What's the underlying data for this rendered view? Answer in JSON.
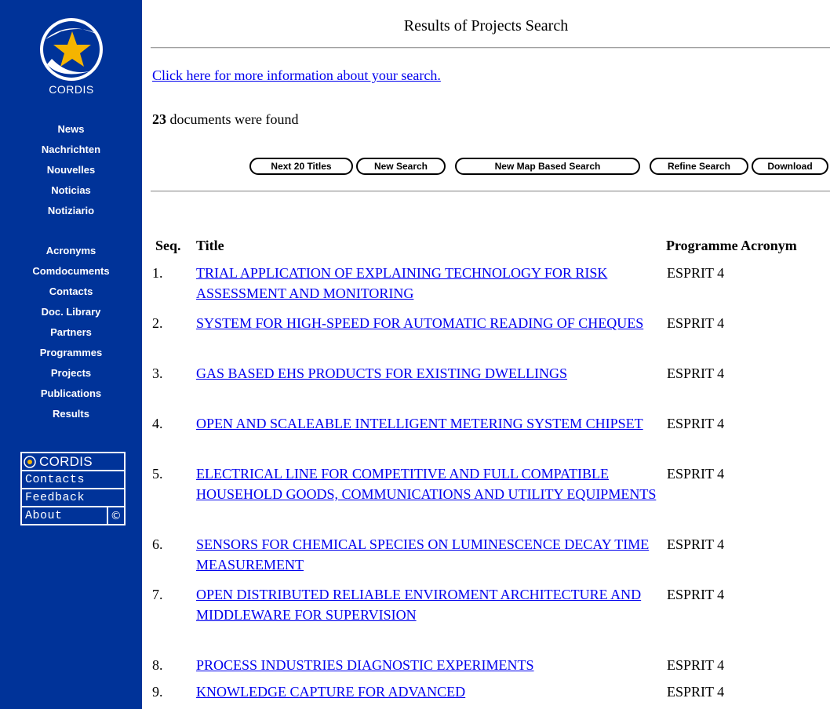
{
  "sidebar": {
    "logo_text": "CORDIS",
    "nav1": [
      "News",
      "Nachrichten",
      "Nouvelles",
      "Noticias",
      "Notiziario"
    ],
    "nav2": [
      "Acronyms",
      "Comdocuments",
      "Contacts",
      "Doc. Library",
      "Partners",
      "Programmes",
      "Projects",
      "Publications",
      "Results"
    ],
    "box": {
      "brand": "CORDIS",
      "contacts": "Contacts",
      "feedback": "Feedback",
      "about": "About",
      "copyright": "©"
    }
  },
  "main": {
    "title": "Results of Projects Search",
    "info_link": "Click here for more information about your search.",
    "count": "23",
    "count_text": " documents were found",
    "buttons": {
      "next": "Next 20 Titles",
      "new_search": "New Search",
      "map_search": "New Map Based Search",
      "refine": "Refine Search",
      "download": "Download"
    },
    "headers": {
      "seq": "Seq.",
      "title": "Title",
      "programme": "Programme Acronym"
    },
    "rows": [
      {
        "seq": "1.",
        "title": "TRIAL APPLICATION OF EXPLAINING TECHNOLOGY FOR RISK ASSESSMENT AND MONITORING",
        "programme": "ESPRIT 4"
      },
      {
        "seq": "2.",
        "title": "SYSTEM FOR HIGH-SPEED FOR AUTOMATIC READING OF CHEQUES",
        "programme": "ESPRIT 4"
      },
      {
        "seq": "3.",
        "title": "GAS BASED EHS PRODUCTS FOR EXISTING DWELLINGS",
        "programme": "ESPRIT 4"
      },
      {
        "seq": "4.",
        "title": "OPEN AND SCALEABLE INTELLIGENT METERING SYSTEM CHIPSET",
        "programme": "ESPRIT 4"
      },
      {
        "seq": "5.",
        "title": "ELECTRICAL LINE FOR COMPETITIVE AND FULL COMPATIBLE HOUSEHOLD GOODS, COMMUNICATIONS AND UTILITY EQUIPMENTS",
        "programme": "ESPRIT 4"
      },
      {
        "seq": "6.",
        "title": "SENSORS FOR CHEMICAL SPECIES ON LUMINESCENCE DECAY TIME MEASUREMENT",
        "programme": "ESPRIT 4"
      },
      {
        "seq": "7.",
        "title": "OPEN DISTRIBUTED RELIABLE ENVIROMENT ARCHITECTURE AND MIDDLEWARE FOR SUPERVISION",
        "programme": "ESPRIT 4"
      },
      {
        "seq": "8.",
        "title": "PROCESS INDUSTRIES DIAGNOSTIC EXPERIMENTS",
        "programme": "ESPRIT 4"
      },
      {
        "seq": "9.",
        "title": "KNOWLEDGE CAPTURE FOR ADVANCED",
        "programme": "ESPRIT 4"
      }
    ]
  }
}
